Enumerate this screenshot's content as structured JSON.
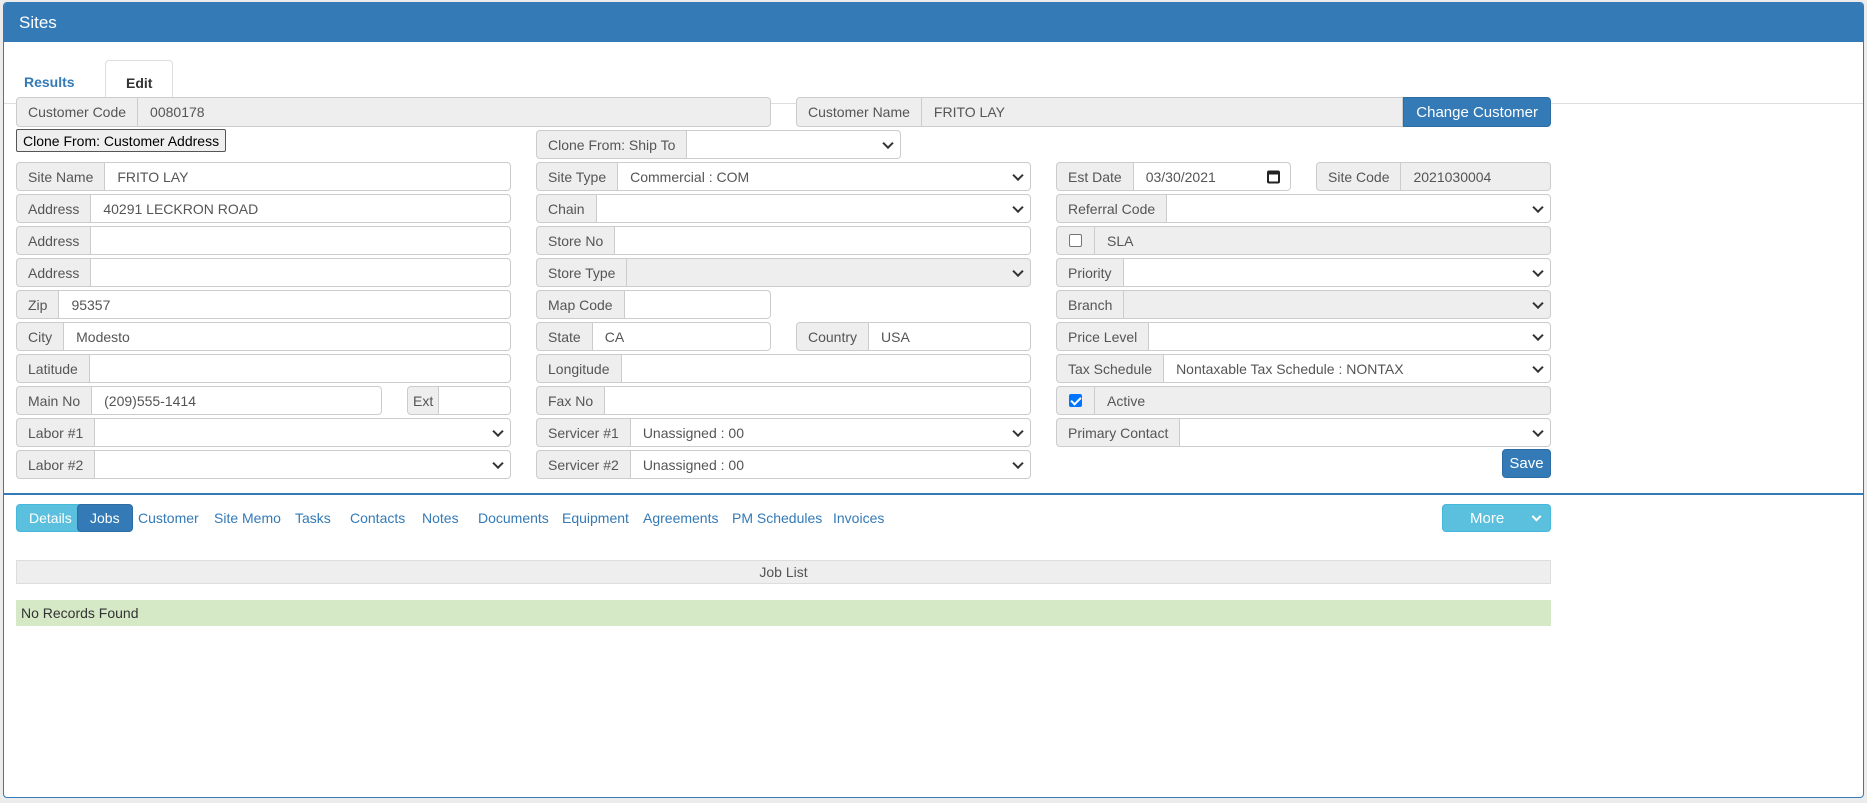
{
  "panel": {
    "title": "Sites"
  },
  "tabs": [
    {
      "label": "Results"
    },
    {
      "label": "Edit"
    }
  ],
  "form": {
    "customer_code": {
      "label": "Customer Code",
      "value": "0080178"
    },
    "customer_name": {
      "label": "Customer Name",
      "value": "FRITO LAY"
    },
    "change_customer": "Change Customer",
    "clone_customer_address": "Clone From: Customer Address",
    "clone_ship_to": {
      "label": "Clone From: Ship To",
      "value": ""
    },
    "site_name": {
      "label": "Site Name",
      "value": "FRITO LAY"
    },
    "address1": {
      "label": "Address",
      "value": "40291 LECKRON ROAD"
    },
    "address2": {
      "label": "Address",
      "value": ""
    },
    "address3": {
      "label": "Address",
      "value": ""
    },
    "zip": {
      "label": "Zip",
      "value": "95357"
    },
    "city": {
      "label": "City",
      "value": "Modesto"
    },
    "latitude": {
      "label": "Latitude",
      "value": ""
    },
    "main_no": {
      "label": "Main No",
      "value": "(209)555-1414"
    },
    "ext": {
      "label": "Ext",
      "value": ""
    },
    "labor1": {
      "label": "Labor #1",
      "value": ""
    },
    "labor2": {
      "label": "Labor #2",
      "value": ""
    },
    "site_type": {
      "label": "Site Type",
      "value": "Commercial : COM"
    },
    "chain": {
      "label": "Chain",
      "value": ""
    },
    "store_no": {
      "label": "Store No",
      "value": ""
    },
    "store_type": {
      "label": "Store Type",
      "value": ""
    },
    "map_code": {
      "label": "Map Code",
      "value": ""
    },
    "state": {
      "label": "State",
      "value": "CA"
    },
    "country": {
      "label": "Country",
      "value": "USA"
    },
    "longitude": {
      "label": "Longitude",
      "value": ""
    },
    "fax_no": {
      "label": "Fax No",
      "value": ""
    },
    "servicer1": {
      "label": "Servicer #1",
      "value": "Unassigned : 00"
    },
    "servicer2": {
      "label": "Servicer #2",
      "value": "Unassigned : 00"
    },
    "est_date": {
      "label": "Est Date",
      "value": "03/30/2021"
    },
    "site_code": {
      "label": "Site Code",
      "value": "2021030004"
    },
    "referral_code": {
      "label": "Referral Code",
      "value": ""
    },
    "sla": {
      "label": "SLA",
      "checked": false
    },
    "priority": {
      "label": "Priority",
      "value": ""
    },
    "branch": {
      "label": "Branch",
      "value": ""
    },
    "price_level": {
      "label": "Price Level",
      "value": ""
    },
    "tax_schedule": {
      "label": "Tax Schedule",
      "value": "Nontaxable Tax Schedule : NONTAX"
    },
    "active": {
      "label": "Active",
      "checked": true
    },
    "primary_contact": {
      "label": "Primary Contact",
      "value": ""
    },
    "save": "Save"
  },
  "subnav": {
    "items": [
      {
        "label": "Details"
      },
      {
        "label": "Jobs"
      },
      {
        "label": "Customer"
      },
      {
        "label": "Site Memo"
      },
      {
        "label": "Tasks"
      },
      {
        "label": "Contacts"
      },
      {
        "label": "Notes"
      },
      {
        "label": "Documents"
      },
      {
        "label": "Equipment"
      },
      {
        "label": "Agreements"
      },
      {
        "label": "PM Schedules"
      },
      {
        "label": "Invoices"
      }
    ],
    "more": "More"
  },
  "job_list": {
    "title": "Job List",
    "empty": "No Records Found"
  },
  "colors": {
    "primary": "#337ab7",
    "info": "#5bc0de",
    "success_bg": "#d6e9c6"
  }
}
